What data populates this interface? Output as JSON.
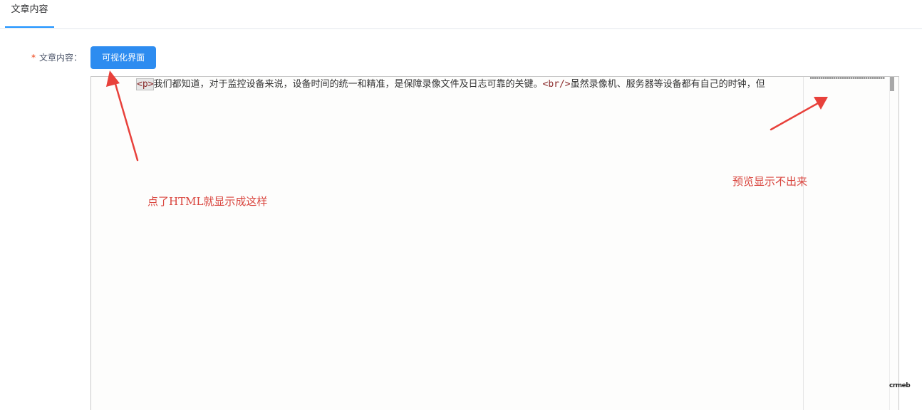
{
  "tabs": [
    {
      "label": "文章内容",
      "active": true
    }
  ],
  "form": {
    "required_mark": "*",
    "label": "文章内容：",
    "visual_button_label": "可视化界面"
  },
  "editor": {
    "code": {
      "p_open": "<p>",
      "text_1": "我们都知道，对于监控设备来说，设备时间的统一和精准，是保障录像文件及日志可靠的关键。",
      "br_tag": "<br/>",
      "text_2": "虽然录像机、服务器等设备都有自己的时钟，但"
    },
    "watermark": "crmeb"
  },
  "annotations": {
    "left_note": "点了HTML就显示成这样",
    "right_note": "预览显示不出来"
  },
  "colors": {
    "accent": "#2d8cf0",
    "tab_underline": "#1890ff",
    "required": "#ed4014",
    "annotation": "#e8413b"
  }
}
